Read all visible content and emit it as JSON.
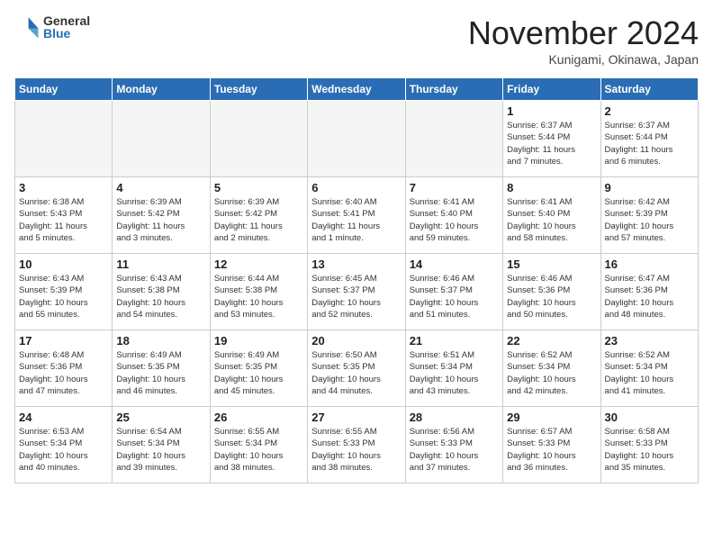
{
  "header": {
    "logo_general": "General",
    "logo_blue": "Blue",
    "month_title": "November 2024",
    "location": "Kunigami, Okinawa, Japan"
  },
  "weekdays": [
    "Sunday",
    "Monday",
    "Tuesday",
    "Wednesday",
    "Thursday",
    "Friday",
    "Saturday"
  ],
  "weeks": [
    [
      {
        "day": "",
        "info": ""
      },
      {
        "day": "",
        "info": ""
      },
      {
        "day": "",
        "info": ""
      },
      {
        "day": "",
        "info": ""
      },
      {
        "day": "",
        "info": ""
      },
      {
        "day": "1",
        "info": "Sunrise: 6:37 AM\nSunset: 5:44 PM\nDaylight: 11 hours\nand 7 minutes."
      },
      {
        "day": "2",
        "info": "Sunrise: 6:37 AM\nSunset: 5:44 PM\nDaylight: 11 hours\nand 6 minutes."
      }
    ],
    [
      {
        "day": "3",
        "info": "Sunrise: 6:38 AM\nSunset: 5:43 PM\nDaylight: 11 hours\nand 5 minutes."
      },
      {
        "day": "4",
        "info": "Sunrise: 6:39 AM\nSunset: 5:42 PM\nDaylight: 11 hours\nand 3 minutes."
      },
      {
        "day": "5",
        "info": "Sunrise: 6:39 AM\nSunset: 5:42 PM\nDaylight: 11 hours\nand 2 minutes."
      },
      {
        "day": "6",
        "info": "Sunrise: 6:40 AM\nSunset: 5:41 PM\nDaylight: 11 hours\nand 1 minute."
      },
      {
        "day": "7",
        "info": "Sunrise: 6:41 AM\nSunset: 5:40 PM\nDaylight: 10 hours\nand 59 minutes."
      },
      {
        "day": "8",
        "info": "Sunrise: 6:41 AM\nSunset: 5:40 PM\nDaylight: 10 hours\nand 58 minutes."
      },
      {
        "day": "9",
        "info": "Sunrise: 6:42 AM\nSunset: 5:39 PM\nDaylight: 10 hours\nand 57 minutes."
      }
    ],
    [
      {
        "day": "10",
        "info": "Sunrise: 6:43 AM\nSunset: 5:39 PM\nDaylight: 10 hours\nand 55 minutes."
      },
      {
        "day": "11",
        "info": "Sunrise: 6:43 AM\nSunset: 5:38 PM\nDaylight: 10 hours\nand 54 minutes."
      },
      {
        "day": "12",
        "info": "Sunrise: 6:44 AM\nSunset: 5:38 PM\nDaylight: 10 hours\nand 53 minutes."
      },
      {
        "day": "13",
        "info": "Sunrise: 6:45 AM\nSunset: 5:37 PM\nDaylight: 10 hours\nand 52 minutes."
      },
      {
        "day": "14",
        "info": "Sunrise: 6:46 AM\nSunset: 5:37 PM\nDaylight: 10 hours\nand 51 minutes."
      },
      {
        "day": "15",
        "info": "Sunrise: 6:46 AM\nSunset: 5:36 PM\nDaylight: 10 hours\nand 50 minutes."
      },
      {
        "day": "16",
        "info": "Sunrise: 6:47 AM\nSunset: 5:36 PM\nDaylight: 10 hours\nand 48 minutes."
      }
    ],
    [
      {
        "day": "17",
        "info": "Sunrise: 6:48 AM\nSunset: 5:36 PM\nDaylight: 10 hours\nand 47 minutes."
      },
      {
        "day": "18",
        "info": "Sunrise: 6:49 AM\nSunset: 5:35 PM\nDaylight: 10 hours\nand 46 minutes."
      },
      {
        "day": "19",
        "info": "Sunrise: 6:49 AM\nSunset: 5:35 PM\nDaylight: 10 hours\nand 45 minutes."
      },
      {
        "day": "20",
        "info": "Sunrise: 6:50 AM\nSunset: 5:35 PM\nDaylight: 10 hours\nand 44 minutes."
      },
      {
        "day": "21",
        "info": "Sunrise: 6:51 AM\nSunset: 5:34 PM\nDaylight: 10 hours\nand 43 minutes."
      },
      {
        "day": "22",
        "info": "Sunrise: 6:52 AM\nSunset: 5:34 PM\nDaylight: 10 hours\nand 42 minutes."
      },
      {
        "day": "23",
        "info": "Sunrise: 6:52 AM\nSunset: 5:34 PM\nDaylight: 10 hours\nand 41 minutes."
      }
    ],
    [
      {
        "day": "24",
        "info": "Sunrise: 6:53 AM\nSunset: 5:34 PM\nDaylight: 10 hours\nand 40 minutes."
      },
      {
        "day": "25",
        "info": "Sunrise: 6:54 AM\nSunset: 5:34 PM\nDaylight: 10 hours\nand 39 minutes."
      },
      {
        "day": "26",
        "info": "Sunrise: 6:55 AM\nSunset: 5:34 PM\nDaylight: 10 hours\nand 38 minutes."
      },
      {
        "day": "27",
        "info": "Sunrise: 6:55 AM\nSunset: 5:33 PM\nDaylight: 10 hours\nand 38 minutes."
      },
      {
        "day": "28",
        "info": "Sunrise: 6:56 AM\nSunset: 5:33 PM\nDaylight: 10 hours\nand 37 minutes."
      },
      {
        "day": "29",
        "info": "Sunrise: 6:57 AM\nSunset: 5:33 PM\nDaylight: 10 hours\nand 36 minutes."
      },
      {
        "day": "30",
        "info": "Sunrise: 6:58 AM\nSunset: 5:33 PM\nDaylight: 10 hours\nand 35 minutes."
      }
    ]
  ]
}
